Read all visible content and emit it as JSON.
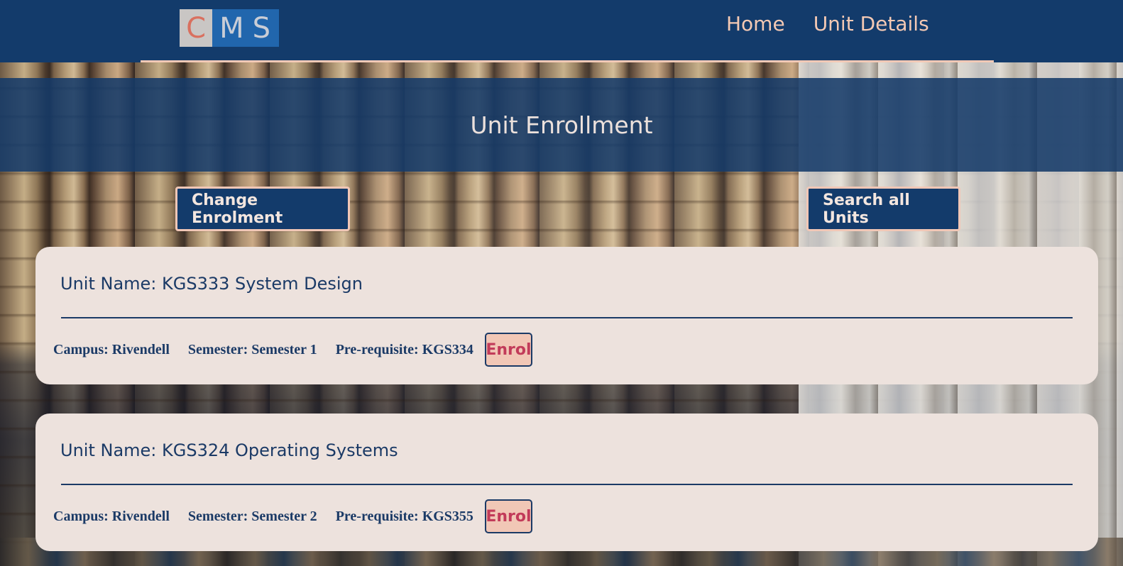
{
  "nav": {
    "logo_c": "C",
    "logo_ms": "MS",
    "links": [
      "Home",
      "Unit Details"
    ]
  },
  "hero": {
    "title": "Unit Enrollment"
  },
  "actions": {
    "change_enrolment": "Change Enrolment",
    "search_all_units": "Search all Units"
  },
  "units": [
    {
      "name": "Unit Name: KGS333 System Design",
      "campus": "Campus: Rivendell",
      "semester": "Semester: Semester 1",
      "prerequisite": "Pre-requisite: KGS334",
      "enrol_label": "Enrol"
    },
    {
      "name": "Unit Name: KGS324 Operating Systems",
      "campus": "Campus: Rivendell",
      "semester": "Semester: Semester 2",
      "prerequisite": "Pre-requisite: KGS355",
      "enrol_label": "Enrol"
    }
  ],
  "colors": {
    "navy": "#133b6b",
    "peach": "#f1c7b6",
    "card": "#ede2dd",
    "enrol_text": "#c23b59"
  }
}
